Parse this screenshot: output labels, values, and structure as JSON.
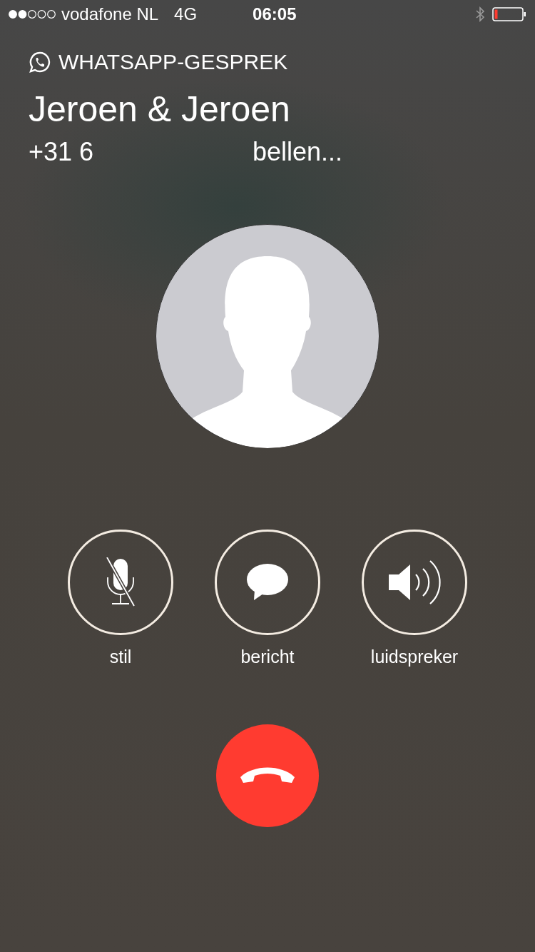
{
  "status_bar": {
    "carrier": "vodafone NL",
    "network": "4G",
    "time": "06:05"
  },
  "call": {
    "type": "WHATSAPP-GESPREK",
    "name": "Jeroen & Jeroen",
    "number": "+31 6",
    "status": "bellen..."
  },
  "buttons": [
    {
      "kind": "mute",
      "label": "stil"
    },
    {
      "kind": "message",
      "label": "bericht"
    },
    {
      "kind": "speaker",
      "label": "luidspreker"
    }
  ]
}
